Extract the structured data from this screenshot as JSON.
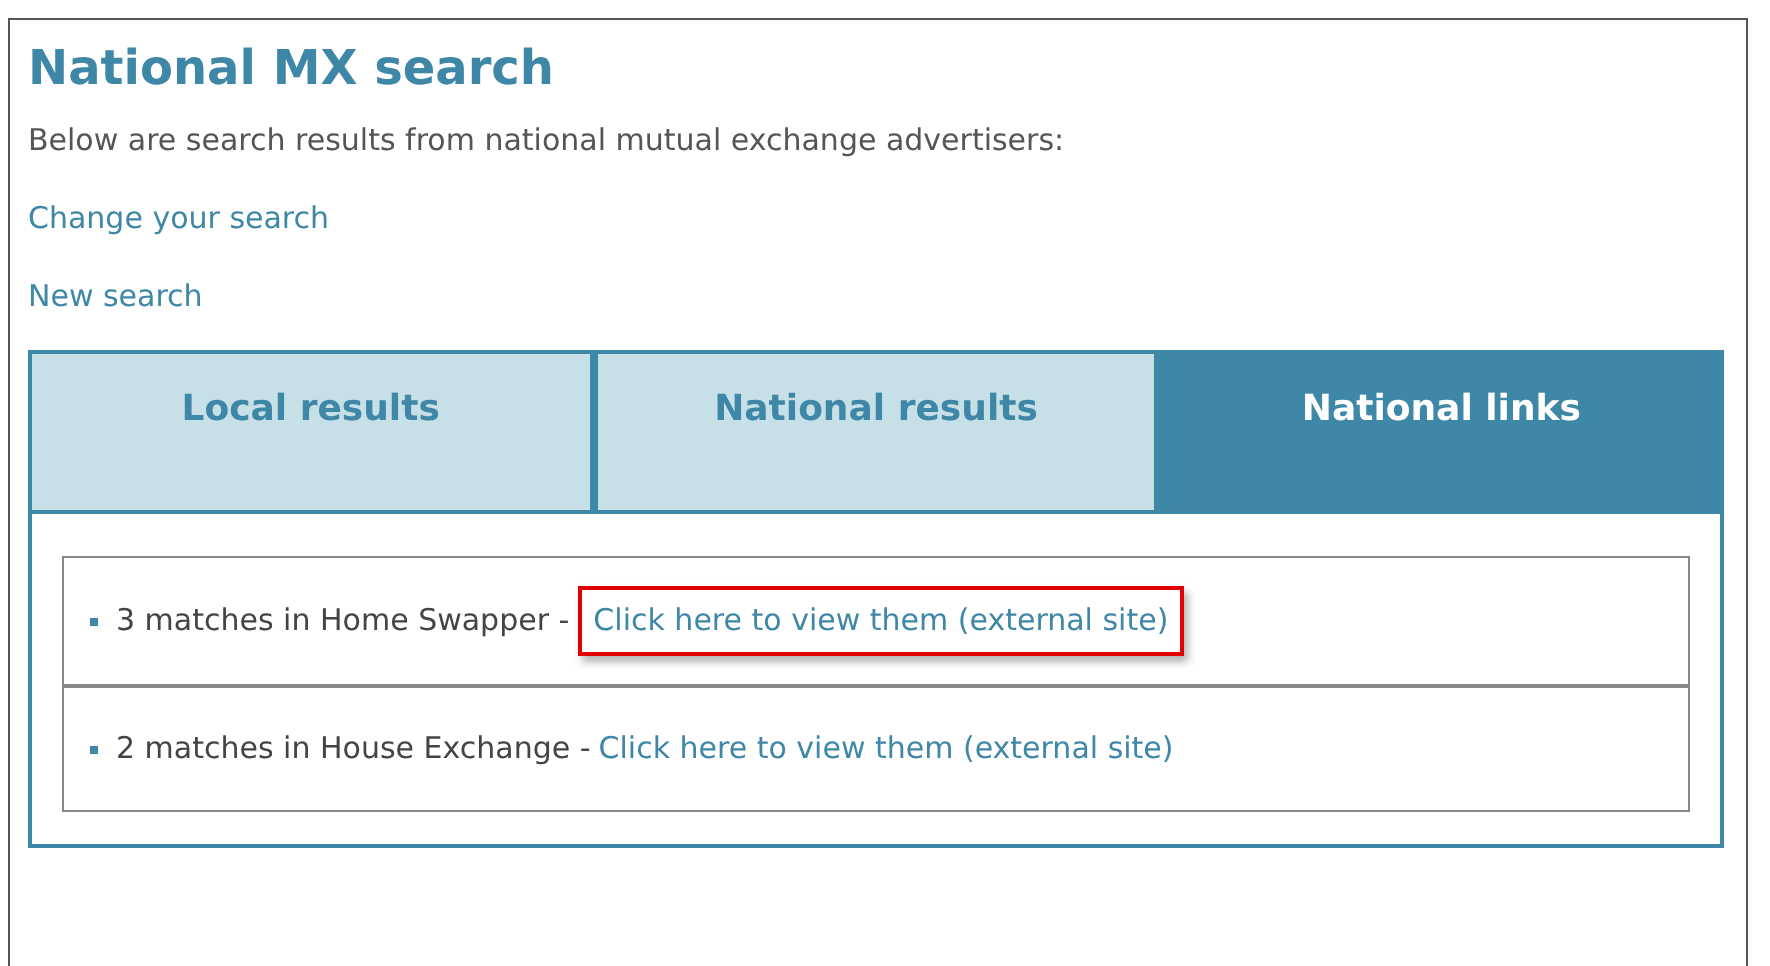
{
  "title": "National MX search",
  "intro": "Below are search results from national mutual exchange advertisers:",
  "links": [
    "Change your search",
    "New search"
  ],
  "tabs": [
    {
      "label": "Local results",
      "selected": false
    },
    {
      "label": "National results",
      "selected": false
    },
    {
      "label": "National links",
      "selected": true
    }
  ],
  "results": [
    {
      "text": "3 matches in Home Swapper -",
      "link": "Click here to view them (external site)",
      "highlighted": true
    },
    {
      "text": "2 matches in House Exchange -",
      "link": "Click here to view them (external site)",
      "highlighted": false
    }
  ]
}
